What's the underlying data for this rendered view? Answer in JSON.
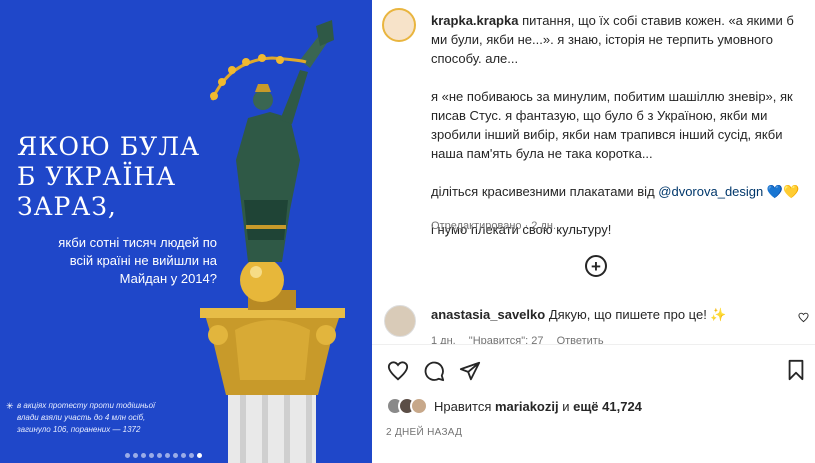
{
  "image": {
    "headline": [
      "ЯКОЮ БУЛА",
      "Б УКРАЇНА",
      "ЗАРАЗ,"
    ],
    "subtext": [
      "якби сотні тисяч людей по",
      "всій країні не вийшли на",
      "Майдан у 2014?"
    ],
    "note": [
      "в акціях протесту проти тодішньої",
      "влади взяли участь до 4 млн осіб,",
      "загинуло 106, поранених — 1372"
    ],
    "note_icon": "star-icon",
    "dots_count": 10,
    "dots_active_index": 9,
    "background": "#1f47c9"
  },
  "caption": {
    "username": "krapka.krapka",
    "para1": "питання, що їх собі ставив кожен. «а якими б ми були, якби не...». я знаю, історія не терпить умовного способу. але...",
    "para2": "я «не побиваюсь за минулим, побитим шашіллю зневір», як писав Стус. я фантазую, що було б з Україною, якби ми зробили інший вибір, якби нам трапився інший сусід, якби наша пам'ять була не така коротка...",
    "para3_text": "діліться красивезними плакатами від ",
    "para3_link": "@dvorova_design",
    "para3_hearts": " 💙💛",
    "para4": "і нумо плекати свою культуру!",
    "meta": "Отредактировано · 2 дн."
  },
  "comment": {
    "username": "anastasia_savelko",
    "text": "Дякую, що пишете про це! ✨",
    "age": "1 дн.",
    "likes": "\"Нравится\": 27",
    "reply": "Ответить"
  },
  "likes": {
    "prefix": "Нравится",
    "user": "mariakozij",
    "conj": "и",
    "count": "ещё 41,724"
  },
  "date": "2 ДНЕЙ НАЗАД"
}
